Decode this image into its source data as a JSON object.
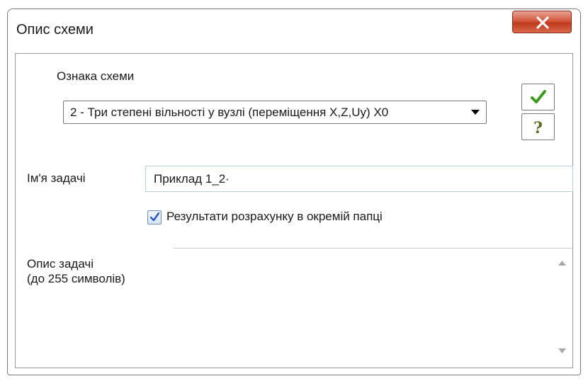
{
  "window": {
    "title": "Опис схеми"
  },
  "scheme": {
    "label": "Ознака схеми",
    "selected": "2 - Три степені вільності у вузлі (переміщення X,Z,Uy) X0"
  },
  "task_name": {
    "label": "Ім'я задачі",
    "value": "Приклад 1_2·"
  },
  "options": {
    "separate_folder_label": "Результати розрахунку в окремій папці",
    "separate_folder_checked": true
  },
  "description": {
    "label_line1": "Опис задачі",
    "label_line2": "(до 255 символів)",
    "value": ""
  },
  "buttons": {
    "ok_icon": "checkmark-icon",
    "help_icon": "question-mark-icon",
    "close_icon": "close-x-icon"
  },
  "colors": {
    "close_button": "#c0391d",
    "ok_check": "#3e9a1e",
    "help_mark": "#5a6b1f",
    "checkbox_mark": "#2a56b8"
  }
}
